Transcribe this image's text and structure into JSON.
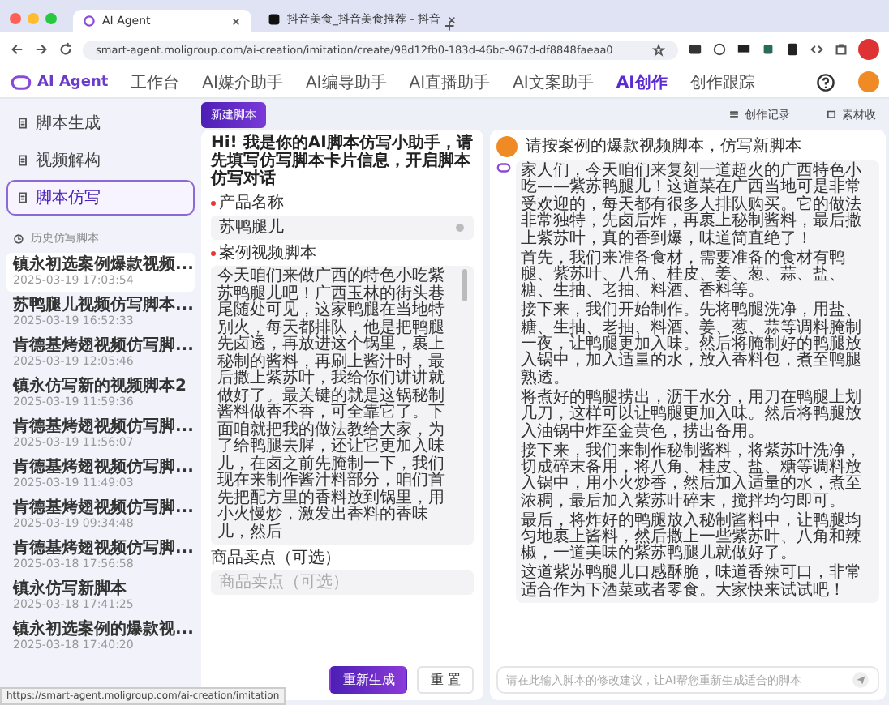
{
  "browser": {
    "tabs": [
      {
        "title": "AI Agent",
        "selected": true
      },
      {
        "title": "抖音美食_抖音美食推荐 - 抖音",
        "selected": false
      }
    ],
    "url": "smart-agent.moligroup.com/ai-creation/imitation/create/98d12fb0-183d-46bc-967d-df8848faeaa0"
  },
  "nav": {
    "logo": "AI Agent",
    "items": [
      {
        "label": "工作台",
        "selected": false
      },
      {
        "label": "AI媒介助手",
        "selected": false
      },
      {
        "label": "AI编导助手",
        "selected": false
      },
      {
        "label": "AI直播助手",
        "selected": false
      },
      {
        "label": "AI文案助手",
        "selected": false
      },
      {
        "label": "AI创作",
        "selected": true
      },
      {
        "label": "创作跟踪",
        "selected": false
      }
    ]
  },
  "toolbar": {
    "new_button": "新建脚本",
    "links": [
      "创作记录",
      "素材收"
    ]
  },
  "sidebar": {
    "items": [
      {
        "label": "脚本生成",
        "selected": false
      },
      {
        "label": "视频解构",
        "selected": false
      },
      {
        "label": "脚本仿写",
        "selected": true
      }
    ],
    "history_title": "历史仿写脚本",
    "history": [
      {
        "title": "镇永初选案例爆款视频...",
        "date": "2025-03-19 17:03:54",
        "selected": true
      },
      {
        "title": "苏鸭腿儿视频仿写脚本...",
        "date": "2025-03-19 16:52:33",
        "selected": false
      },
      {
        "title": "肯德基烤翅视频仿写脚...",
        "date": "2025-03-19 12:05:46",
        "selected": false
      },
      {
        "title": "镇永仿写新的视频脚本2",
        "date": "2025-03-19 11:59:36",
        "selected": false
      },
      {
        "title": "肯德基烤翅视频仿写脚...",
        "date": "2025-03-19 11:56:07",
        "selected": false
      },
      {
        "title": "肯德基烤翅视频仿写脚...",
        "date": "2025-03-19 11:49:03",
        "selected": false
      },
      {
        "title": "肯德基烤翅视频仿写脚...",
        "date": "2025-03-19 09:34:48",
        "selected": false
      },
      {
        "title": "肯德基烤翅视频仿写脚...",
        "date": "2025-03-18 17:56:58",
        "selected": false
      },
      {
        "title": "镇永仿写新脚本",
        "date": "2025-03-18 17:41:25",
        "selected": false
      },
      {
        "title": "镇永初选案例的爆款视...",
        "date": "2025-03-18 17:40:20",
        "selected": false
      }
    ]
  },
  "form": {
    "intro": "Hi! 我是你的AI脚本仿写小助手，请先填写仿写脚本卡片信息，开启脚本仿写对话",
    "fields": [
      {
        "kind": "input",
        "label": "产品名称",
        "required": true,
        "value": "苏鸭腿儿"
      },
      {
        "kind": "textarea",
        "label": "案例视频脚本",
        "required": true,
        "value": "今天咱们来做广西的特色小吃紫苏鸭腿儿吧！广西玉林的街头巷尾随处可见，这家鸭腿在当地特别火，每天都排队，他是把鸭腿先卤透，再放进这个锅里，裹上秘制的酱料，再刷上酱汁时，最后撒上紫苏叶，我给你们讲讲就做好了。最关键的就是这锅秘制酱料做香不香，可全靠它了。下面咱就把我的做法教给大家，为了给鸭腿去腥，还让它更加入味儿，在卤之前先腌制一下，我们现在来制作酱汁料部分，咱们首先把配方里的香料放到锅里，用小火慢炒，激发出香料的香味儿，然后"
      },
      {
        "kind": "input",
        "label": "商品卖点（可选）",
        "required": false,
        "placeholder": "商品卖点（可选）"
      }
    ],
    "buttons": [
      {
        "label": "重新生成",
        "kind": "primary"
      },
      {
        "label": "重 置",
        "kind": "default"
      }
    ]
  },
  "chat": {
    "prompt": "请按案例的爆款视频脚本，仿写新脚本",
    "reply": [
      "家人们，今天咱们来复刻一道超火的广西特色小吃——紫苏鸭腿儿！这道菜在广西当地可是非常受欢迎的，每天都有很多人排队购买。它的做法非常独特，先卤后炸，再裹上秘制酱料，最后撒上紫苏叶，真的香到爆，味道简直绝了！",
      "首先，我们来准备食材，需要准备的食材有鸭腿、紫苏叶、八角、桂皮、姜、葱、蒜、盐、糖、生抽、老抽、料酒、香料等。",
      "接下来，我们开始制作。先将鸭腿洗净，用盐、糖、生抽、老抽、料酒、姜、葱、蒜等调料腌制一夜，让鸭腿更加入味。然后将腌制好的鸭腿放入锅中，加入适量的水，放入香料包，煮至鸭腿熟透。",
      "将煮好的鸭腿捞出，沥干水分，用刀在鸭腿上划几刀，这样可以让鸭腿更加入味。然后将鸭腿放入油锅中炸至金黄色，捞出备用。",
      "接下来，我们来制作秘制酱料，将紫苏叶洗净，切成碎末备用，将八角、桂皮、盐、糖等调料放入锅中，用小火炒香，然后加入适量的水，煮至浓稠，最后加入紫苏叶碎末，搅拌均匀即可。",
      "最后，将炸好的鸭腿放入秘制酱料中，让鸭腿均匀地裹上酱料，然后撒上一些紫苏叶、八角和辣椒，一道美味的紫苏鸭腿儿就做好了。",
      "这道紫苏鸭腿儿口感酥脆，味道香辣可口，非常适合作为下酒菜或者零食。大家快来试试吧！"
    ],
    "input_placeholder": "请在此输入脚本的修改建议，让AI帮您重新生成适合的脚本"
  },
  "status_url": "https://smart-agent.moligroup.com/ai-creation/imitation"
}
